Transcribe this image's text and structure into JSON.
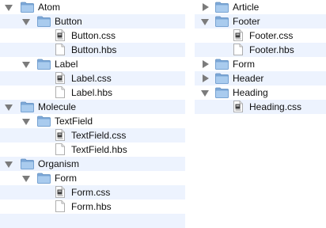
{
  "left": {
    "atom": "Atom",
    "button": "Button",
    "button_css": "Button.css",
    "button_hbs": "Button.hbs",
    "label": "Label",
    "label_css": "Label.css",
    "label_hbs": "Label.hbs",
    "molecule": "Molecule",
    "textfield": "TextField",
    "textfield_css": "TextField.css",
    "textfield_hbs": "TextField.hbs",
    "organism": "Organism",
    "form": "Form",
    "form_css": "Form.css",
    "form_hbs": "Form.hbs"
  },
  "right": {
    "article": "Article",
    "footer": "Footer",
    "footer_css": "Footer.css",
    "footer_hbs": "Footer.hbs",
    "form": "Form",
    "header": "Header",
    "heading": "Heading",
    "heading_css": "Heading.css"
  },
  "icons": {
    "folder": "folder-icon",
    "css_file": "css-file-icon",
    "text_file": "text-file-icon",
    "expanded": "disclosure-expanded-icon",
    "collapsed": "disclosure-collapsed-icon"
  },
  "colors": {
    "stripe": "#edf3fe",
    "folder": "#8fb8e3",
    "disclosure": "#7b7b7b"
  }
}
